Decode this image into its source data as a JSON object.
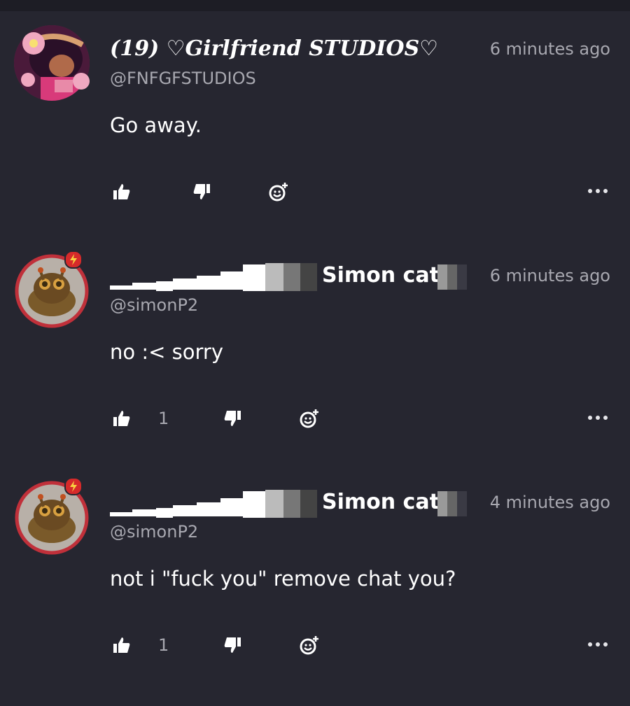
{
  "comments": [
    {
      "display_name": "(19) ♡Girlfriend STUDIOS♡",
      "handle": "@FNFGFSTUDIOS",
      "timestamp": "6 minutes ago",
      "body": "Go away.",
      "like_count": "",
      "avatar_icon": "girlfriend-avatar",
      "verified_badge": false
    },
    {
      "display_name": "Simon cat",
      "handle": "@simonP2",
      "timestamp": "6 minutes ago",
      "body": "no :< sorry",
      "like_count": "1",
      "avatar_icon": "simon-cat-avatar",
      "verified_badge": true
    },
    {
      "display_name": "Simon cat",
      "handle": "@simonP2",
      "timestamp": "4 minutes ago",
      "body": "not i \"fuck you\" remove chat you?",
      "like_count": "1",
      "avatar_icon": "simon-cat-avatar",
      "verified_badge": true
    }
  ],
  "icons": {
    "like": "thumbs-up-icon",
    "dislike": "thumbs-down-icon",
    "react": "add-reaction-icon",
    "more": "more-options-icon"
  },
  "colors": {
    "background": "#262630",
    "text_primary": "#ffffff",
    "text_secondary": "#a8a8b0",
    "badge_red": "#d62a2a"
  }
}
